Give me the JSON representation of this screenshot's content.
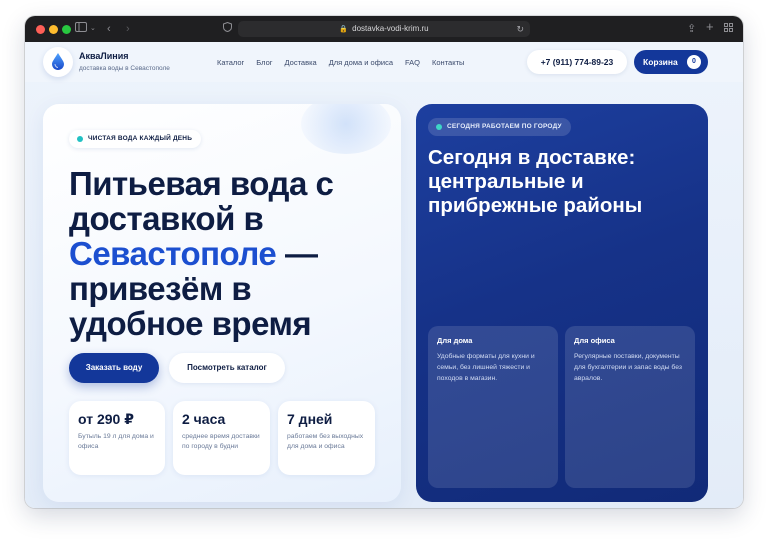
{
  "browser": {
    "url": "dostavka-vodi-krim.ru"
  },
  "brand": {
    "name": "АкваЛиния",
    "tagline": "доставка воды в Севастополе"
  },
  "nav": [
    {
      "label": "Каталог"
    },
    {
      "label": "Блог"
    },
    {
      "label": "Доставка"
    },
    {
      "label": "Для дома и офиса"
    },
    {
      "label": "FAQ"
    },
    {
      "label": "Контакты"
    }
  ],
  "header": {
    "phone": "+7 (911) 774-89-23",
    "cart_label": "Корзина",
    "cart_count": "0"
  },
  "hero": {
    "badge": "ЧИСТАЯ ВОДА КАЖДЫЙ ДЕНЬ",
    "title_part1": "Питьевая вода с доставкой в ",
    "title_accent": "Севастополе",
    "title_part2": " — привезём в удобное время",
    "cta_primary": "Заказать воду",
    "cta_secondary": "Посмотреть каталог",
    "stats": [
      {
        "value": "от 290 ₽",
        "desc": "Бутыль 19 л для дома и офиса"
      },
      {
        "value": "2 часа",
        "desc": "среднее время доставки по городу в будни"
      },
      {
        "value": "7 дней",
        "desc": "работаем без выходных для дома и офиса"
      }
    ]
  },
  "delivery": {
    "badge": "СЕГОДНЯ РАБОТАЕМ ПО ГОРОДУ",
    "title": "Сегодня в доставке: центральные и прибрежные районы",
    "features": [
      {
        "title": "Для дома",
        "desc": "Удобные форматы для кухни и семьи, без лишней тяжести и походов в магазин."
      },
      {
        "title": "Для офиса",
        "desc": "Регулярные поставки, документы для бухгалтерии и запас воды без авралов."
      }
    ]
  },
  "colors": {
    "primary": "#13379a",
    "accent_text": "#1c4fd0",
    "heading": "#0e1d43"
  }
}
